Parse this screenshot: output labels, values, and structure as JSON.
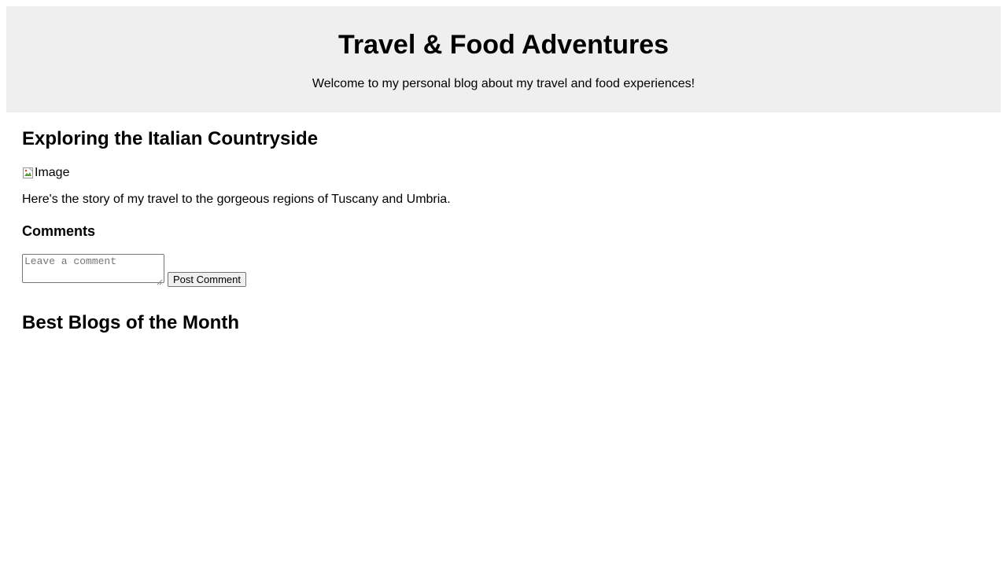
{
  "header": {
    "title": "Travel & Food Adventures",
    "tagline": "Welcome to my personal blog about my travel and food experiences!",
    "background_color": "#efefef"
  },
  "post": {
    "title": "Exploring the Italian Countryside",
    "image_alt": "Image",
    "image_icon": "broken-image-icon",
    "body": "Here's the story of my travel to the gorgeous regions of Tuscany and Umbria."
  },
  "comments": {
    "heading": "Comments",
    "input_value": "",
    "input_placeholder": "Leave a comment",
    "submit_label": "Post Comment"
  },
  "best_blogs": {
    "heading": "Best Blogs of the Month"
  }
}
